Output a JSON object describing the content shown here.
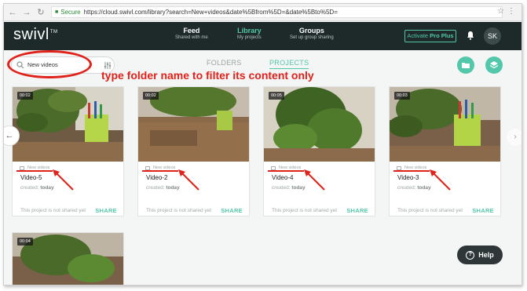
{
  "browser": {
    "secure_label": "Secure",
    "url": "https://cloud.swivl.com/library?search=New+videos&date%5Bfrom%5D=&date%5Bto%5D="
  },
  "header": {
    "logo": "swivl",
    "logo_tm": "TM",
    "nav": [
      {
        "title": "Feed",
        "subtitle": "Shared with me"
      },
      {
        "title": "Library",
        "subtitle": "My projects"
      },
      {
        "title": "Groups",
        "subtitle": "Set up group sharing"
      }
    ],
    "activate_prefix": "Activate",
    "activate_plan": "Pro Plus",
    "avatar_initials": "SK",
    "accent": "#52c7a9",
    "bar_color": "#1e2a2a"
  },
  "toolbar": {
    "search_value": "New videos",
    "tabs": [
      "FOLDERS",
      "PROJECTS"
    ],
    "active_tab": "PROJECTS"
  },
  "annotation": {
    "callout": "type folder name to filter its content only",
    "color": "#e0221b"
  },
  "cards": [
    {
      "duration": "00:02",
      "folder": "New videos",
      "title": "Video-5",
      "created_label": "created:",
      "created_value": "today",
      "shared_text": "This project is not shared yet",
      "share_label": "SHARE"
    },
    {
      "duration": "00:02",
      "folder": "New videos",
      "title": "Video-2",
      "created_label": "created:",
      "created_value": "today",
      "shared_text": "This project is not shared yet",
      "share_label": "SHARE"
    },
    {
      "duration": "00:05",
      "folder": "New videos",
      "title": "Video-4",
      "created_label": "created:",
      "created_value": "today",
      "shared_text": "This project is not shared yet",
      "share_label": "SHARE"
    },
    {
      "duration": "00:03",
      "folder": "New videos",
      "title": "Video-3",
      "created_label": "created:",
      "created_value": "today",
      "shared_text": "This project is not shared yet",
      "share_label": "SHARE"
    }
  ],
  "card5": {
    "duration": "00:04"
  },
  "help_label": "Help"
}
